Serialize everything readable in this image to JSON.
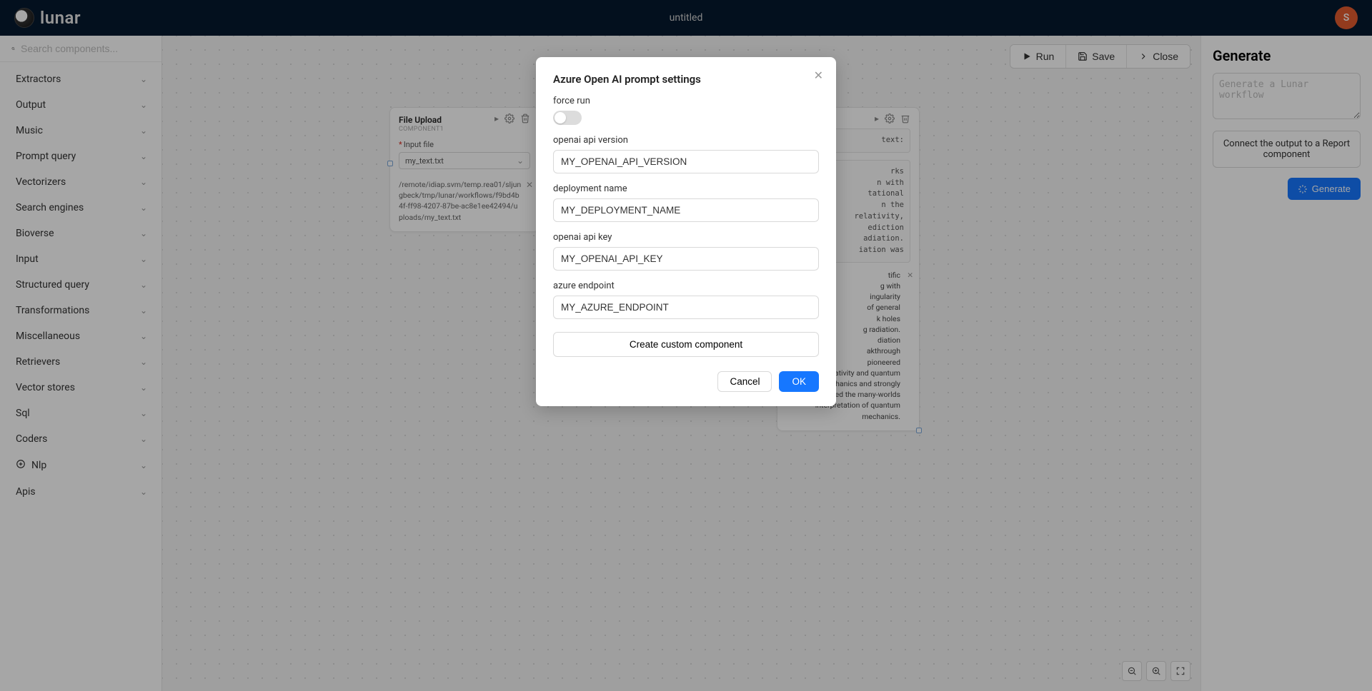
{
  "app": {
    "name": "lunar",
    "doc_title": "untitled",
    "avatar_initial": "S"
  },
  "search": {
    "placeholder": "Search components..."
  },
  "sidebar": {
    "items": [
      {
        "label": "Extractors"
      },
      {
        "label": "Output"
      },
      {
        "label": "Music"
      },
      {
        "label": "Prompt query"
      },
      {
        "label": "Vectorizers"
      },
      {
        "label": "Search engines"
      },
      {
        "label": "Bioverse"
      },
      {
        "label": "Input"
      },
      {
        "label": "Structured query"
      },
      {
        "label": "Transformations"
      },
      {
        "label": "Miscellaneous"
      },
      {
        "label": "Retrievers"
      },
      {
        "label": "Vector stores"
      },
      {
        "label": "Sql"
      },
      {
        "label": "Coders"
      },
      {
        "label": "Nlp",
        "icon": true
      },
      {
        "label": "Apis"
      }
    ]
  },
  "toolbar": {
    "run": "Run",
    "save": "Save",
    "close": "Close"
  },
  "node1": {
    "title": "File Upload",
    "sub": "COMPONENT1",
    "input_label": "Input file",
    "file": "my_text.txt",
    "path": "/remote/idiap.svm/temp.rea01/sljungbeck/tmp/lunar/workflows/f9bd4b4f-ff98-4207-87be-ac8e1ee42494/uploads/my_text.txt"
  },
  "node2": {
    "header_snip": "text:",
    "result_pre": "rks\nn with\ntational\nn the\nrelativity,\nediction\nadiation.\niation was",
    "result_text": "tific\ng with\ningularity\nof general\nk holes\ng radiation.\ndiation\nakthrough\npioneered\ns general relativity and quantum mechanics and strongly supported the many-worlds interpretation of quantum mechanics."
  },
  "rightpanel": {
    "title": "Generate",
    "placeholder": "Generate a Lunar workflow",
    "note": "Connect the output to a Report component",
    "button": "Generate"
  },
  "modal": {
    "title": "Azure Open AI prompt settings",
    "force_run": "force run",
    "api_version_label": "openai api version",
    "api_version_value": "MY_OPENAI_API_VERSION",
    "deployment_label": "deployment name",
    "deployment_value": "MY_DEPLOYMENT_NAME",
    "api_key_label": "openai api key",
    "api_key_value": "MY_OPENAI_API_KEY",
    "endpoint_label": "azure endpoint",
    "endpoint_value": "MY_AZURE_ENDPOINT",
    "create": "Create custom component",
    "cancel": "Cancel",
    "ok": "OK"
  }
}
